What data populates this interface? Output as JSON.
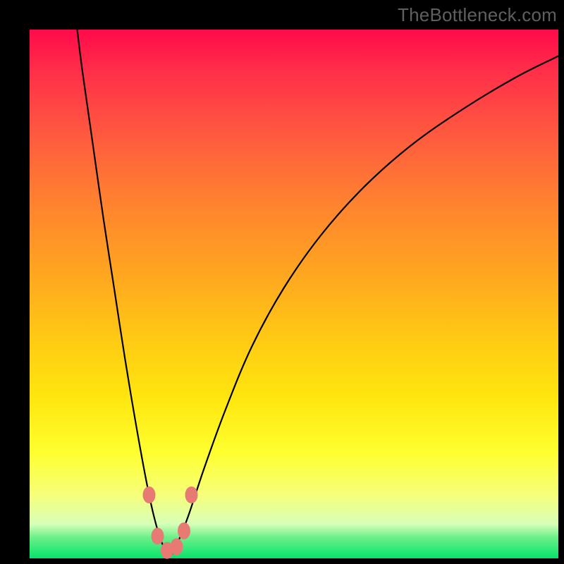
{
  "watermark": "TheBottleneck.com",
  "chart_data": {
    "type": "line",
    "title": "",
    "xlabel": "",
    "ylabel": "",
    "xlim": [
      0,
      100
    ],
    "ylim": [
      0,
      100
    ],
    "grid": false,
    "series": [
      {
        "name": "bottleneck-curve",
        "x": [
          9,
          10,
          12,
          14,
          16,
          18,
          20,
          22,
          23.5,
          25,
          26.5,
          28,
          30,
          33,
          37,
          42,
          48,
          55,
          63,
          72,
          82,
          92,
          100
        ],
        "y": [
          100,
          92,
          78,
          64,
          51,
          38,
          26,
          15,
          8,
          3,
          0.5,
          3,
          8,
          17,
          28,
          40,
          51,
          61,
          70,
          78,
          85,
          91,
          95
        ]
      }
    ],
    "markers": [
      {
        "name": "dot-left-upper",
        "x": 22.6,
        "y": 12.0
      },
      {
        "name": "dot-left-lower",
        "x": 24.2,
        "y": 4.2
      },
      {
        "name": "dot-mid-left",
        "x": 26.0,
        "y": 1.5
      },
      {
        "name": "dot-mid-right",
        "x": 27.8,
        "y": 2.2
      },
      {
        "name": "dot-right-lower",
        "x": 29.2,
        "y": 5.2
      },
      {
        "name": "dot-right-upper",
        "x": 30.6,
        "y": 12.0
      }
    ],
    "marker_color": "#e77b74",
    "curve_color": "#000000"
  }
}
